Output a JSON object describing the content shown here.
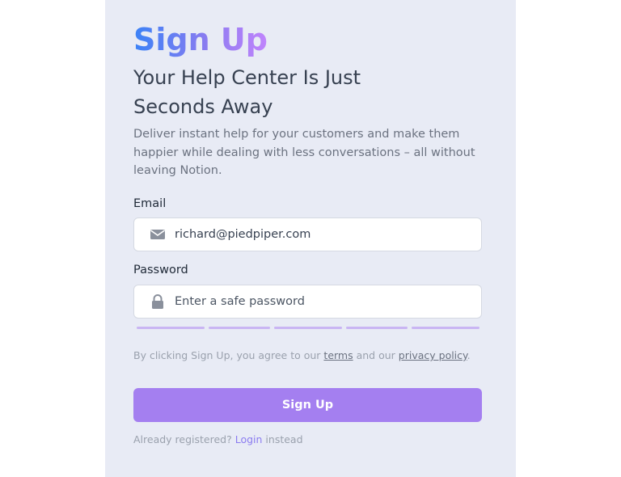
{
  "header": {
    "title": "Sign Up",
    "subtitle": "Your Help Center Is Just Seconds Away",
    "description": "Deliver instant help for your customers and make them happier while dealing with less conversations – all without leaving Notion."
  },
  "form": {
    "email_label": "Email",
    "email_value": "richard@piedpiper.com",
    "email_icon": "envelope-icon",
    "password_label": "Password",
    "password_placeholder": "Enter a safe password",
    "password_icon": "lock-icon",
    "password_strength_segments": 5,
    "password_strength_level": 0
  },
  "terms": {
    "prefix": "By clicking Sign Up, you agree to our ",
    "terms_link": "terms",
    "middle": " and our ",
    "privacy_link": "privacy policy",
    "suffix": "."
  },
  "submit": {
    "label": "Sign Up"
  },
  "login": {
    "prefix": "Already registered? ",
    "link": "Login",
    "suffix": " instead"
  },
  "colors": {
    "panel_background": "#e8ebf5",
    "accent": "#a47ff0",
    "title_gradient_start": "#3b82f6",
    "title_gradient_end": "#c084fc",
    "strength_bar": "#c9b5f3",
    "login_link": "#8b7cf0"
  }
}
